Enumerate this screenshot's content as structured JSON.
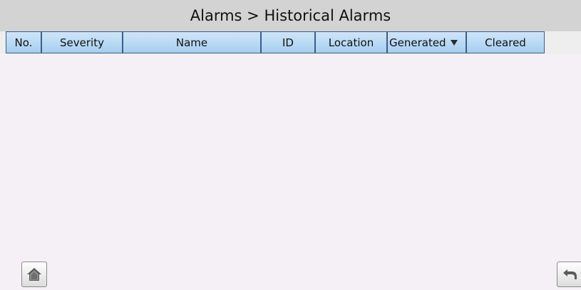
{
  "header": {
    "title": "Alarms > Historical Alarms"
  },
  "table": {
    "columns": [
      {
        "key": "no",
        "label": "No."
      },
      {
        "key": "severity",
        "label": "Severity"
      },
      {
        "key": "name",
        "label": "Name"
      },
      {
        "key": "id",
        "label": "ID"
      },
      {
        "key": "location",
        "label": "Location"
      },
      {
        "key": "generated",
        "label": "Generated",
        "sorted": "descending"
      },
      {
        "key": "cleared",
        "label": "Cleared"
      }
    ],
    "rows": []
  },
  "footer": {
    "home_icon": "home-icon",
    "back_icon": "back-arrow-icon"
  },
  "colors": {
    "header_gradient_top": "#cfe5f8",
    "header_gradient_bottom": "#a5cff0",
    "header_border": "#3d5d8a",
    "title_bar": "#d3d3d3",
    "background": "#f5f0f5"
  }
}
